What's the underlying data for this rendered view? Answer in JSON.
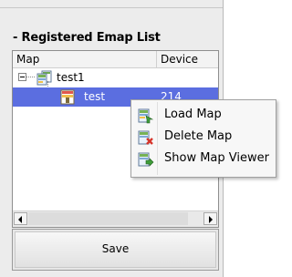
{
  "section": {
    "title": "- Registered Emap List"
  },
  "tree": {
    "columns": {
      "map": "Map",
      "device": "Device"
    },
    "rows": [
      {
        "label": "test1",
        "device": ""
      },
      {
        "label": "test",
        "device": "214"
      }
    ]
  },
  "context_menu": {
    "items": [
      {
        "label": "Load Map",
        "icon": "load-map-icon"
      },
      {
        "label": "Delete Map",
        "icon": "delete-map-icon"
      },
      {
        "label": "Show Map Viewer",
        "icon": "show-map-viewer-icon"
      }
    ]
  },
  "footer": {
    "save_label": "Save"
  },
  "colors": {
    "selection": "#5b6ee0",
    "panel": "#ececec"
  }
}
